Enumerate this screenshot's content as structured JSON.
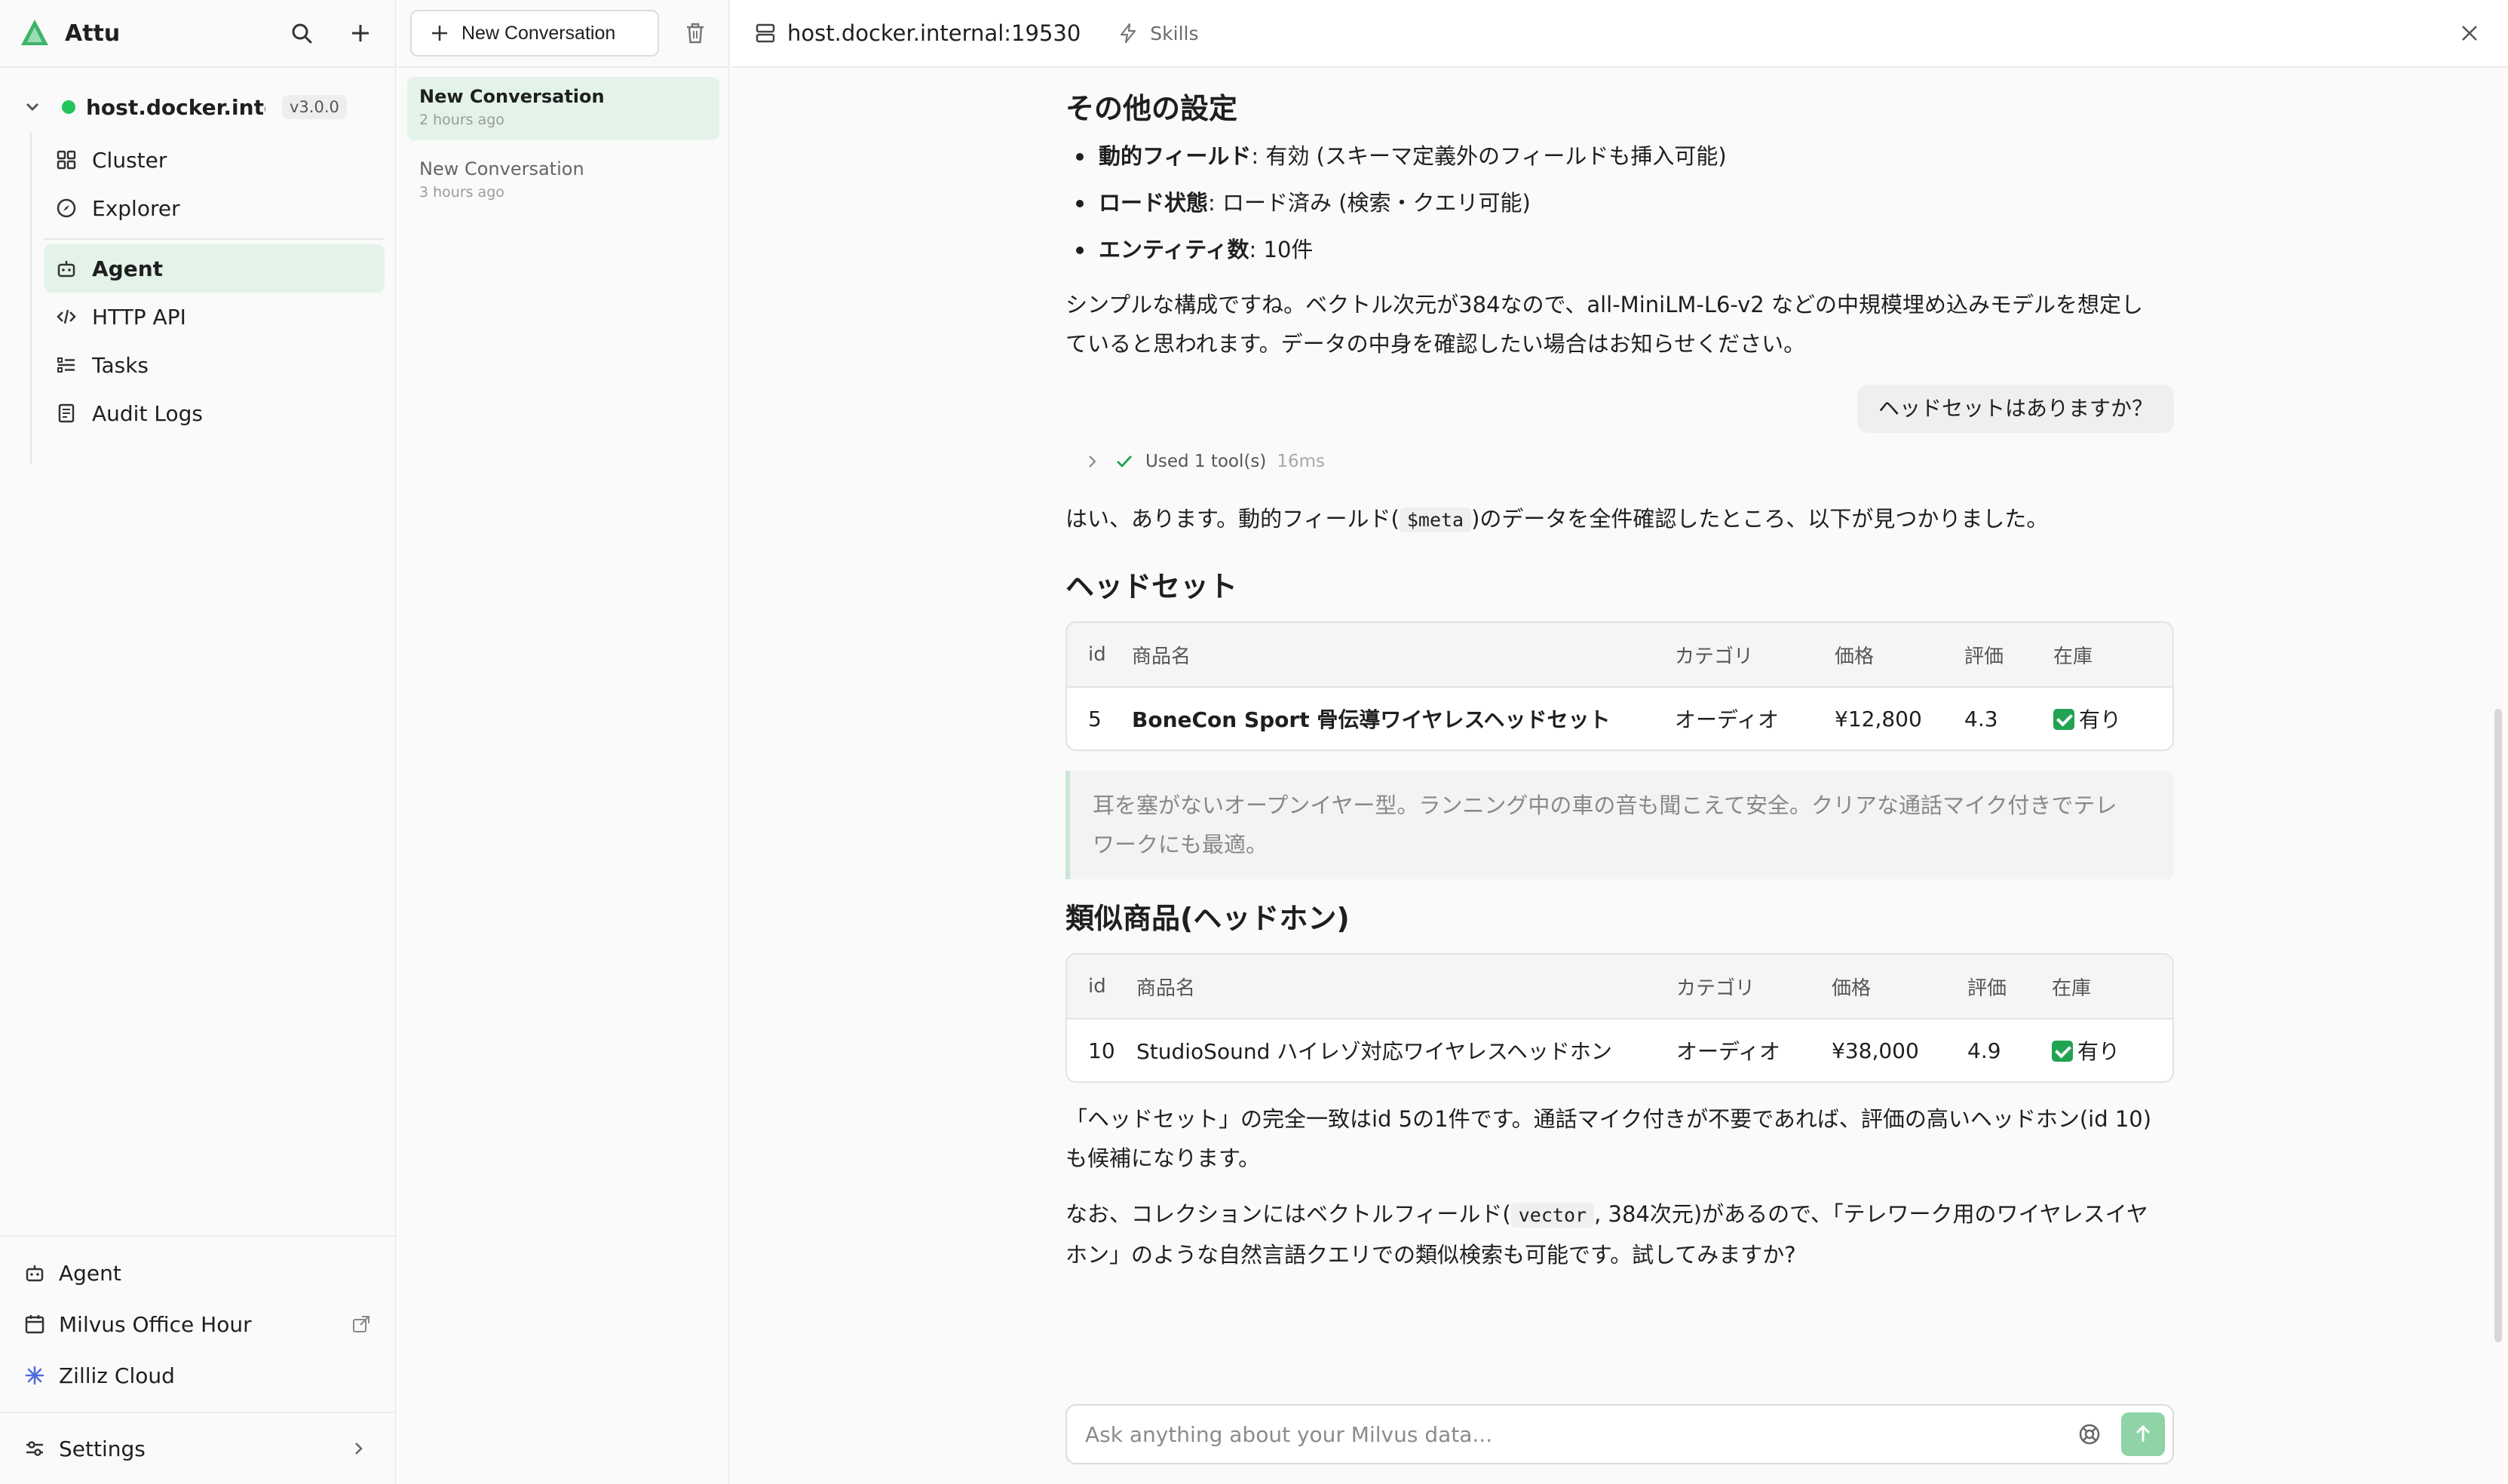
{
  "sidebar": {
    "app_title": "Attu",
    "connection": {
      "name": "host.docker.inte...",
      "version": "v3.0.0"
    },
    "nav": [
      {
        "label": "Cluster",
        "icon": "cluster-icon"
      },
      {
        "label": "Explorer",
        "icon": "explorer-icon"
      },
      {
        "label": "Agent",
        "icon": "agent-icon",
        "active": true
      },
      {
        "label": "HTTP API",
        "icon": "code-icon"
      },
      {
        "label": "Tasks",
        "icon": "tasks-icon"
      },
      {
        "label": "Audit Logs",
        "icon": "audit-logs-icon"
      }
    ],
    "bottom": [
      {
        "label": "Agent",
        "icon": "agent-icon"
      },
      {
        "label": "Milvus Office Hour",
        "icon": "calendar-icon"
      },
      {
        "label": "Zilliz Cloud",
        "icon": "zilliz-icon"
      }
    ],
    "settings_label": "Settings"
  },
  "conversations": {
    "new_label": "New Conversation",
    "items": [
      {
        "title": "New Conversation",
        "time": "2 hours ago"
      },
      {
        "title": "New Conversation",
        "time": "3 hours ago"
      }
    ]
  },
  "topbar": {
    "host": "host.docker.internal:19530",
    "skills": "Skills"
  },
  "chat": {
    "section_other": "その他の設定",
    "bullets": [
      {
        "key": "動的フィールド",
        "value": ": 有効 (スキーマ定義外のフィールドも挿入可能)"
      },
      {
        "key": "ロード状態",
        "value": ": ロード済み (検索・クエリ可能)"
      },
      {
        "key": "エンティティ数",
        "value": ": 10件"
      }
    ],
    "summary_line1": "シンプルな構成ですね。ベクトル次元が384なので、all-MiniLM-L6-v2 などの中規模埋め込みモデルを想定し",
    "summary_line2": "ていると思われます。データの中身を確認したい場合はお知らせください。",
    "user_message": "ヘッドセットはありますか？",
    "tool": {
      "label": "Used 1 tool(s)",
      "ms": "16ms"
    },
    "answer_pre": "はい、あります。動的フィールド(",
    "answer_code": "$meta",
    "answer_post": ")のデータを全件確認したところ、以下が見つかりました。",
    "section_headset": "ヘッドセット",
    "table_headers": [
      "id",
      "商品名",
      "カテゴリ",
      "価格",
      "評価",
      "在庫"
    ],
    "headset_row": {
      "id": "5",
      "name": "BoneCon Sport 骨伝導ワイヤレスヘッドセット",
      "category": "オーディオ",
      "price": "¥12,800",
      "rating": "4.3",
      "stock": "有り"
    },
    "quote_line1": "耳を塞がないオープンイヤー型。ランニング中の車の音も聞こえて安全。クリアな通話マイク付きでテレ",
    "quote_line2": "ワークにも最適。",
    "section_similar": "類似商品(ヘッドホン)",
    "similar_row": {
      "id": "10",
      "name": "StudioSound ハイレゾ対応ワイヤレスヘッドホン",
      "category": "オーディオ",
      "price": "¥38,000",
      "rating": "4.9",
      "stock": "有り"
    },
    "final1_line1": "「ヘッドセット」の完全一致はid 5の1件です。通話マイク付きが不要であれば、評価の高いヘッドホン(id 10)",
    "final1_line2": "も候補になります。",
    "final2_pre": "なお、コレクションにはベクトルフィールド(",
    "final2_code": "vector",
    "final2_post": ", 384次元)があるので、「テレワーク用のワイヤレスイヤ",
    "final2_line2": "ホン」のような自然言語クエリでの類似検索も可能です。試してみますか?"
  },
  "input": {
    "placeholder": "Ask anything about your Milvus data..."
  },
  "colors": {
    "accent": "#22a352",
    "active_bg": "#e3f3e9",
    "send_button": "#8fd3a6"
  }
}
